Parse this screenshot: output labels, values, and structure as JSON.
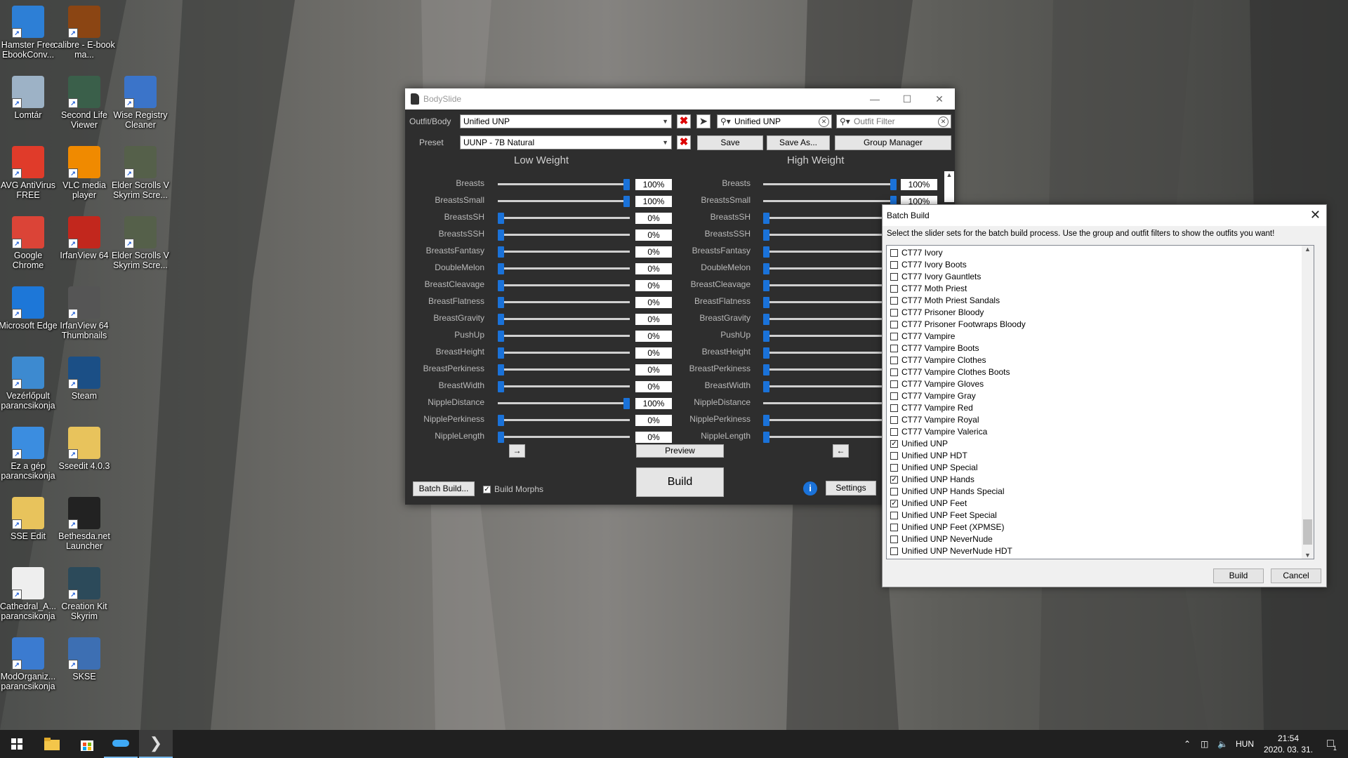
{
  "desktop": {
    "icons": [
      {
        "label": "Hamster Free EbookConv...",
        "icon": "hamster-ebook-icon",
        "color": "#2d7fd6"
      },
      {
        "label": "calibre - E-book ma...",
        "icon": "calibre-icon",
        "color": "#8b4513"
      },
      {
        "label": "Lomtár",
        "icon": "recycle-bin-icon",
        "color": "#9db2c6"
      },
      {
        "label": "Second Life Viewer",
        "icon": "second-life-icon",
        "color": "#3a5f4a"
      },
      {
        "label": "Wise Registry Cleaner",
        "icon": "wise-registry-icon",
        "color": "#3b74c9"
      },
      {
        "label": "AVG AntiVirus FREE",
        "icon": "avg-icon",
        "color": "#e03b2a"
      },
      {
        "label": "VLC media player",
        "icon": "vlc-icon",
        "color": "#f08a00"
      },
      {
        "label": "Elder Scrolls V Skyrim Scre...",
        "icon": "skyrim-screenshot-icon",
        "color": "#55604a"
      },
      {
        "label": "Google Chrome",
        "icon": "chrome-icon",
        "color": "#db4437"
      },
      {
        "label": "IrfanView 64",
        "icon": "irfanview-icon",
        "color": "#c2271d"
      },
      {
        "label": "Elder Scrolls V Skyrim Scre...",
        "icon": "skyrim-screenshot-icon",
        "color": "#55604a"
      },
      {
        "label": "Microsoft Edge",
        "icon": "edge-icon",
        "color": "#1d77d8"
      },
      {
        "label": "IrfanView 64 Thumbnails",
        "icon": "irfanview-thumbnails-icon",
        "color": "#555"
      },
      {
        "label": "Vezérlőpult parancsikonja",
        "icon": "control-panel-icon",
        "color": "#3d8ad0"
      },
      {
        "label": "Steam",
        "icon": "steam-icon",
        "color": "#1b4f86"
      },
      {
        "label": "Ez a gép parancsikonja",
        "icon": "this-pc-icon",
        "color": "#3b8de0"
      },
      {
        "label": "Sseedit 4.0.3",
        "icon": "folder-icon",
        "color": "#e8c35c"
      },
      {
        "label": "SSE Edit",
        "icon": "folder-icon",
        "color": "#e8c35c"
      },
      {
        "label": "Bethesda.net Launcher",
        "icon": "bethesda-icon",
        "color": "#222"
      },
      {
        "label": "Cathedral_A... parancsikonja",
        "icon": "cathedral-icon",
        "color": "#eee"
      },
      {
        "label": "Creation Kit Skyrim",
        "icon": "creation-kit-icon",
        "color": "#2c4a5a"
      },
      {
        "label": "ModOrganiz... parancsikonja",
        "icon": "mod-organizer-icon",
        "color": "#3b7bd0"
      },
      {
        "label": "SKSE",
        "icon": "skse-icon",
        "color": "#3d6fb3"
      }
    ]
  },
  "bodyslide": {
    "title": "BodySlide",
    "outfit_label": "Outfit/Body",
    "outfit_value": "Unified UNP",
    "preset_label": "Preset",
    "preset_value": "UUNP - 7B Natural",
    "search_outfit": "Unified UNP",
    "outfit_filter_placeholder": "Outfit Filter",
    "save": "Save",
    "save_as": "Save As...",
    "group_manager": "Group Manager",
    "low_weight": "Low Weight",
    "high_weight": "High Weight",
    "sliders": [
      {
        "name": "Breasts",
        "low": "100%",
        "low_pct": 100,
        "high": "100%",
        "high_pct": 100
      },
      {
        "name": "BreastsSmall",
        "low": "100%",
        "low_pct": 100,
        "high": "100%",
        "high_pct": 100
      },
      {
        "name": "BreastsSH",
        "low": "0%",
        "low_pct": 0,
        "high": "",
        "high_pct": 0
      },
      {
        "name": "BreastsSSH",
        "low": "0%",
        "low_pct": 0,
        "high": "",
        "high_pct": 0
      },
      {
        "name": "BreastsFantasy",
        "low": "0%",
        "low_pct": 0,
        "high": "",
        "high_pct": 0
      },
      {
        "name": "DoubleMelon",
        "low": "0%",
        "low_pct": 0,
        "high": "",
        "high_pct": 0
      },
      {
        "name": "BreastCleavage",
        "low": "0%",
        "low_pct": 0,
        "high": "",
        "high_pct": 0
      },
      {
        "name": "BreastFlatness",
        "low": "0%",
        "low_pct": 0,
        "high": "",
        "high_pct": 0
      },
      {
        "name": "BreastGravity",
        "low": "0%",
        "low_pct": 0,
        "high": "",
        "high_pct": 0
      },
      {
        "name": "PushUp",
        "low": "0%",
        "low_pct": 0,
        "high": "",
        "high_pct": 0
      },
      {
        "name": "BreastHeight",
        "low": "0%",
        "low_pct": 0,
        "high": "",
        "high_pct": 0
      },
      {
        "name": "BreastPerkiness",
        "low": "0%",
        "low_pct": 0,
        "high": "",
        "high_pct": 0
      },
      {
        "name": "BreastWidth",
        "low": "0%",
        "low_pct": 0,
        "high": "",
        "high_pct": 0
      },
      {
        "name": "NippleDistance",
        "low": "100%",
        "low_pct": 100,
        "high": "",
        "high_pct": 100
      },
      {
        "name": "NipplePerkiness",
        "low": "0%",
        "low_pct": 0,
        "high": "",
        "high_pct": 0
      },
      {
        "name": "NippleLength",
        "low": "0%",
        "low_pct": 0,
        "high": "",
        "high_pct": 0
      }
    ],
    "arrow_right": "→",
    "arrow_left": "←",
    "preview": "Preview",
    "build": "Build",
    "batch_build": "Batch Build...",
    "build_morphs": "Build Morphs",
    "settings": "Settings"
  },
  "batch_build": {
    "title": "Batch Build",
    "instructions": "Select the slider sets for the batch build process. Use the group and outfit filters to show the outfits you want!",
    "items": [
      {
        "label": "CT77 Ivory",
        "checked": false
      },
      {
        "label": "CT77 Ivory Boots",
        "checked": false
      },
      {
        "label": "CT77 Ivory Gauntlets",
        "checked": false
      },
      {
        "label": "CT77 Moth Priest",
        "checked": false
      },
      {
        "label": "CT77 Moth Priest Sandals",
        "checked": false
      },
      {
        "label": "CT77 Prisoner Bloody",
        "checked": false
      },
      {
        "label": "CT77 Prisoner Footwraps Bloody",
        "checked": false
      },
      {
        "label": "CT77 Vampire",
        "checked": false
      },
      {
        "label": "CT77 Vampire Boots",
        "checked": false
      },
      {
        "label": "CT77 Vampire Clothes",
        "checked": false
      },
      {
        "label": "CT77 Vampire Clothes Boots",
        "checked": false
      },
      {
        "label": "CT77 Vampire Gloves",
        "checked": false
      },
      {
        "label": "CT77 Vampire Gray",
        "checked": false
      },
      {
        "label": "CT77 Vampire Red",
        "checked": false
      },
      {
        "label": "CT77 Vampire Royal",
        "checked": false
      },
      {
        "label": "CT77 Vampire Valerica",
        "checked": false
      },
      {
        "label": "Unified UNP",
        "checked": true
      },
      {
        "label": "Unified UNP HDT",
        "checked": false
      },
      {
        "label": "Unified UNP Special",
        "checked": false
      },
      {
        "label": "Unified UNP Hands",
        "checked": true
      },
      {
        "label": "Unified UNP Hands Special",
        "checked": false
      },
      {
        "label": "Unified UNP Feet",
        "checked": true
      },
      {
        "label": "Unified UNP Feet Special",
        "checked": false
      },
      {
        "label": "Unified UNP Feet (XPMSE)",
        "checked": false
      },
      {
        "label": "Unified UNP NeverNude",
        "checked": false
      },
      {
        "label": "Unified UNP NeverNude HDT",
        "checked": false
      }
    ],
    "build": "Build",
    "cancel": "Cancel"
  },
  "taskbar": {
    "language": "HUN",
    "time": "21:54",
    "date": "2020. 03. 31.",
    "notification_count": "1"
  },
  "colors": {
    "accent": "#1a72d9",
    "window_bg": "#2e2e2e",
    "taskbar": "#202020"
  }
}
